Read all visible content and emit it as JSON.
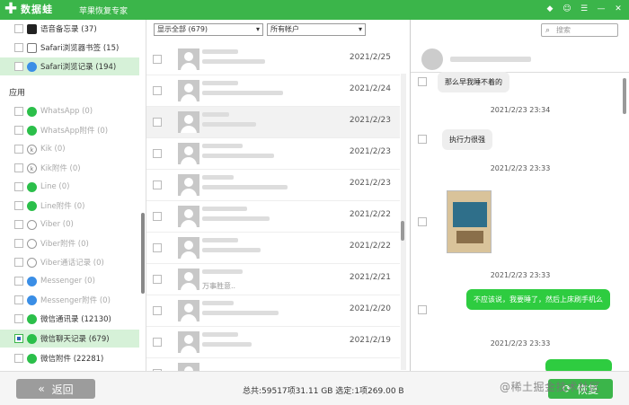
{
  "app": {
    "name": "数据蛙",
    "subtitle": "苹果恢复专家",
    "logo_glyph": "✚"
  },
  "sidebar": {
    "top_items": [
      {
        "label": "语音备忘录 (37)",
        "checked": false,
        "icon": "voice-memo-icon"
      },
      {
        "label": "Safari浏览器书签 (15)",
        "checked": false,
        "icon": "bookmark-icon"
      },
      {
        "label": "Safari浏览记录 (194)",
        "checked": false,
        "icon": "safari-icon",
        "selected": true
      }
    ],
    "section_label": "应用",
    "app_items": [
      {
        "label": "WhatsApp (0)",
        "icon": "whatsapp-icon"
      },
      {
        "label": "WhatsApp附件 (0)",
        "icon": "whatsapp-icon"
      },
      {
        "label": "Kik (0)",
        "icon": "kik-icon"
      },
      {
        "label": "Kik附件 (0)",
        "icon": "kik-icon"
      },
      {
        "label": "Line (0)",
        "icon": "line-icon"
      },
      {
        "label": "Line附件 (0)",
        "icon": "line-icon"
      },
      {
        "label": "Viber (0)",
        "icon": "viber-icon"
      },
      {
        "label": "Viber附件 (0)",
        "icon": "viber-icon"
      },
      {
        "label": "Viber通话记录 (0)",
        "icon": "viber-icon"
      },
      {
        "label": "Messenger (0)",
        "icon": "messenger-icon"
      },
      {
        "label": "Messenger附件 (0)",
        "icon": "messenger-icon"
      },
      {
        "label": "微信通讯录 (12130)",
        "icon": "wechat-icon"
      },
      {
        "label": "微信聊天记录 (679)",
        "icon": "wechat-icon",
        "selected": true,
        "checked": true
      },
      {
        "label": "微信附件 (22281)",
        "icon": "wechat-icon"
      }
    ]
  },
  "list": {
    "filter_show": "显示全部 (679)",
    "filter_account": "所有帐户",
    "rows": [
      {
        "date": "2021/2/25",
        "snippet": ""
      },
      {
        "date": "2021/2/24",
        "snippet": ""
      },
      {
        "date": "2021/2/23",
        "snippet": ""
      },
      {
        "date": "2021/2/23",
        "snippet": ""
      },
      {
        "date": "2021/2/23",
        "snippet": ""
      },
      {
        "date": "2021/2/22",
        "snippet": ""
      },
      {
        "date": "2021/2/22",
        "snippet": ""
      },
      {
        "date": "2021/2/21",
        "snippet": "万事胜意.."
      },
      {
        "date": "2021/2/20",
        "snippet": ""
      },
      {
        "date": "2021/2/19",
        "snippet": ""
      },
      {
        "date": "",
        "snippet": ""
      }
    ]
  },
  "chat": {
    "search_placeholder": "搜索",
    "messages": [
      {
        "text": "那么早我睡不着的",
        "from": "other"
      },
      {
        "ts": "2021/2/23 23:34"
      },
      {
        "text": "执行力很强",
        "from": "other"
      },
      {
        "ts": "2021/2/23 23:33"
      },
      {
        "type": "image",
        "from": "other"
      },
      {
        "ts": "2021/2/23 23:33"
      },
      {
        "text": "不应该说，我要睡了，然后上床刷手机么",
        "from": "me"
      },
      {
        "ts": "2021/2/23 23:33"
      }
    ]
  },
  "footer": {
    "back_label": "返回",
    "back_glyph": "«",
    "stats": "总共:59517项31.11 GB 选定:1项269.00 B",
    "recover_label": "恢复",
    "recover_glyph": "⟳",
    "watermark": "@稀土掘金技术社区"
  },
  "colors": {
    "brand": "#3bb54a",
    "selected_row": "#d6f1d8",
    "bubble_me": "#2ecc40"
  }
}
